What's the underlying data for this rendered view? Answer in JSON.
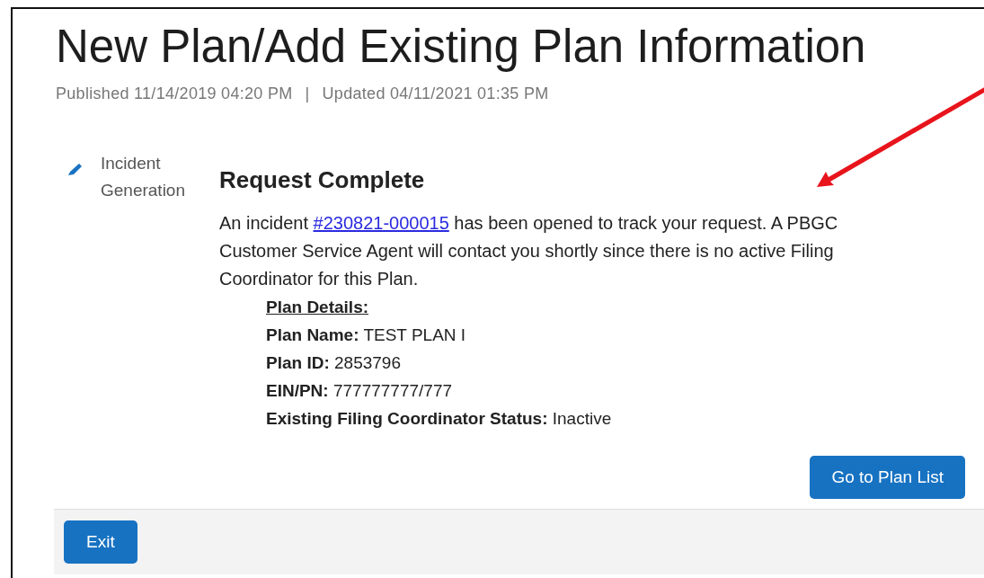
{
  "page": {
    "title": "New Plan/Add Existing Plan Information",
    "published": "Published 11/14/2019 04:20 PM",
    "separator": "|",
    "updated": "Updated 04/11/2021 01:35 PM"
  },
  "sidebar": {
    "items": [
      {
        "label": "Incident Generation",
        "kind": "edit"
      }
    ]
  },
  "result": {
    "heading": "Request Complete",
    "message_before": "An incident ",
    "incident_link": "#230821-000015",
    "message_after": " has been opened to track your request. A PBGC Customer Service Agent will contact you shortly since there is no active Filing Coordinator for this Plan.",
    "details_heading": "Plan Details:",
    "details": [
      "**Plan Name:** TEST PLAN I",
      "**Plan ID:** 2853796",
      "**EIN/PN:** 777777777/777",
      "**Existing Filing Coordinator Status:** Inactive"
    ],
    "button": "Go to Plan List"
  },
  "footer": {
    "button": "Exit"
  },
  "annotation": {
    "kind": "arrow"
  }
}
